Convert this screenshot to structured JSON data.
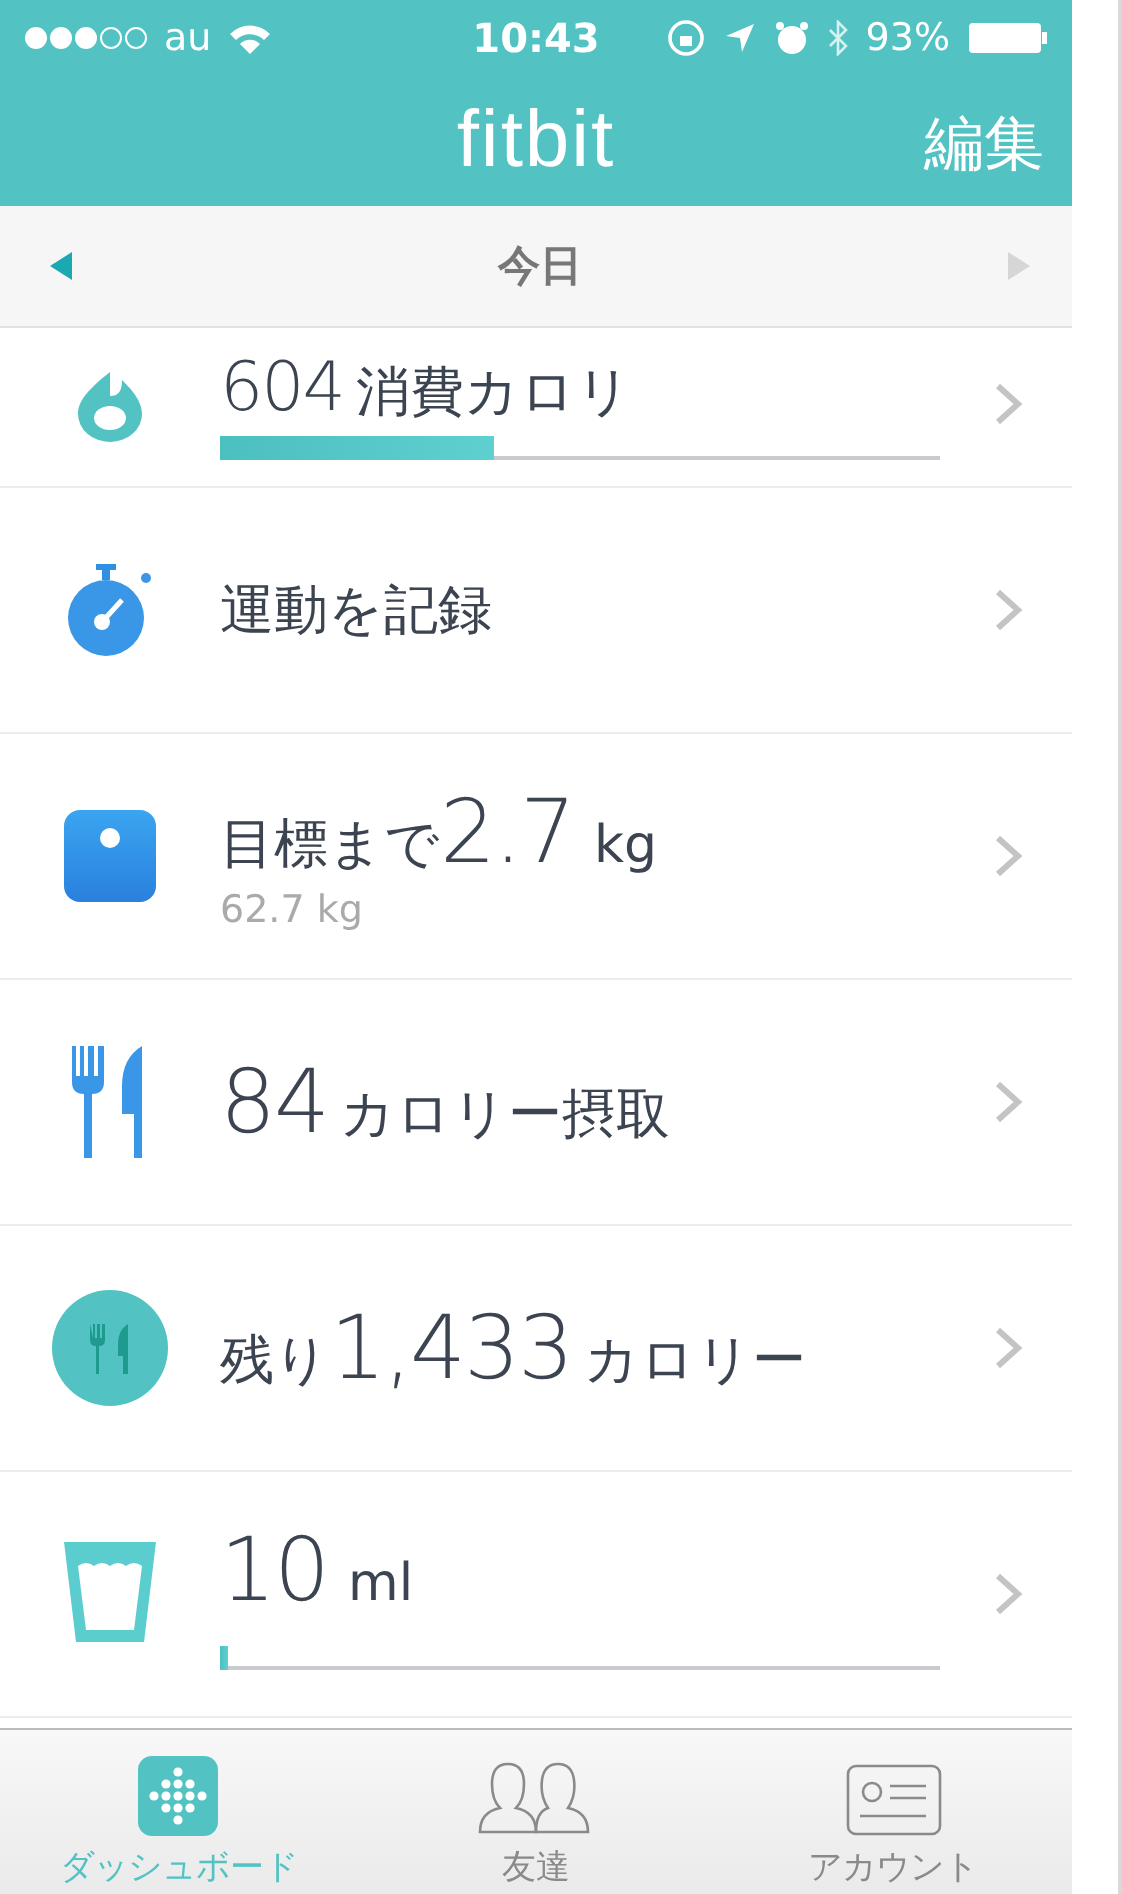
{
  "status_bar": {
    "carrier": "au",
    "time": "10:43",
    "battery": "93%"
  },
  "header": {
    "title": "fitbit",
    "edit": "編集"
  },
  "date_bar": {
    "label": "今日",
    "prev_enabled": true,
    "next_enabled": false
  },
  "rows": [
    {
      "kind": "flame",
      "value": "604",
      "label": "消費カロリ",
      "level": 0.38
    },
    {
      "kind": "stopwatch",
      "label": "運動を記録"
    },
    {
      "kind": "scale",
      "prefix": "目標まで",
      "value": "2.7",
      "unit": "kg",
      "sub": "62.7 kg"
    },
    {
      "kind": "cutlery",
      "value": "84",
      "label": "カロリー摂取"
    },
    {
      "kind": "plate",
      "prefix": "残り",
      "value": "1,433",
      "label": "カロリー"
    },
    {
      "kind": "water",
      "value": "10",
      "unit": "ml",
      "level": 0.01
    }
  ],
  "tabs": [
    {
      "label": "ダッシュボード",
      "kind": "dashboard",
      "selected": true
    },
    {
      "label": "友達",
      "kind": "friends",
      "selected": false
    },
    {
      "label": "アカウント",
      "kind": "account",
      "selected": false
    }
  ]
}
